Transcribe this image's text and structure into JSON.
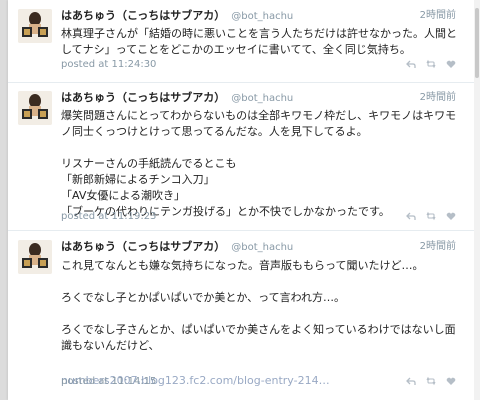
{
  "tweets": [
    {
      "name": "はあちゅう（こっちはサブアカ）",
      "handle": "@bot_hachu",
      "time": "2時間前",
      "body": "林真理子さんが「結婚の時に悪いことを言う人たちだけは許せなかった。人間としてナシ」ってことをどこかのエッセイに書いてて、全く同じ気持ち。",
      "posted": "posted at 11:24:30"
    },
    {
      "name": "はあちゅう（こっちはサブアカ）",
      "handle": "@bot_hachu",
      "time": "2時間前",
      "body": "爆笑問題さんにとってわからないものは全部キワモノ枠だし、キワモノはキワモノ同士くっつけとけって思ってるんだな。人を見下してるよ。\n\nリスナーさんの手紙読んでるとこも\n「新郎新婦によるチンコ入刀」\n「AV女優による潮吹き」\n「ブーケの代わりにテンガ投げる」とか不快でしかなかったです。",
      "posted": "posted at 11:19:23"
    },
    {
      "name": "はあちゅう（こっちはサブアカ）",
      "handle": "@bot_hachu",
      "time": "2時間前",
      "body": "これ見てなんとも嫌な気持ちになった。音声版ももらって聞いたけど…。\n\nろくでなし子とかぱいぱいでか美とか、って言われ方…。\n\nろくでなし子さんとか、ぱいぱいでか美さんをよく知っているわけではないし面識もないんだけど、",
      "link": "numbers2007.blog123.fc2.com/blog-entry-214…",
      "posted": "posted at 11:14:15"
    }
  ],
  "icons": [
    "reply-icon",
    "retweet-icon",
    "like-icon",
    "avatar"
  ]
}
